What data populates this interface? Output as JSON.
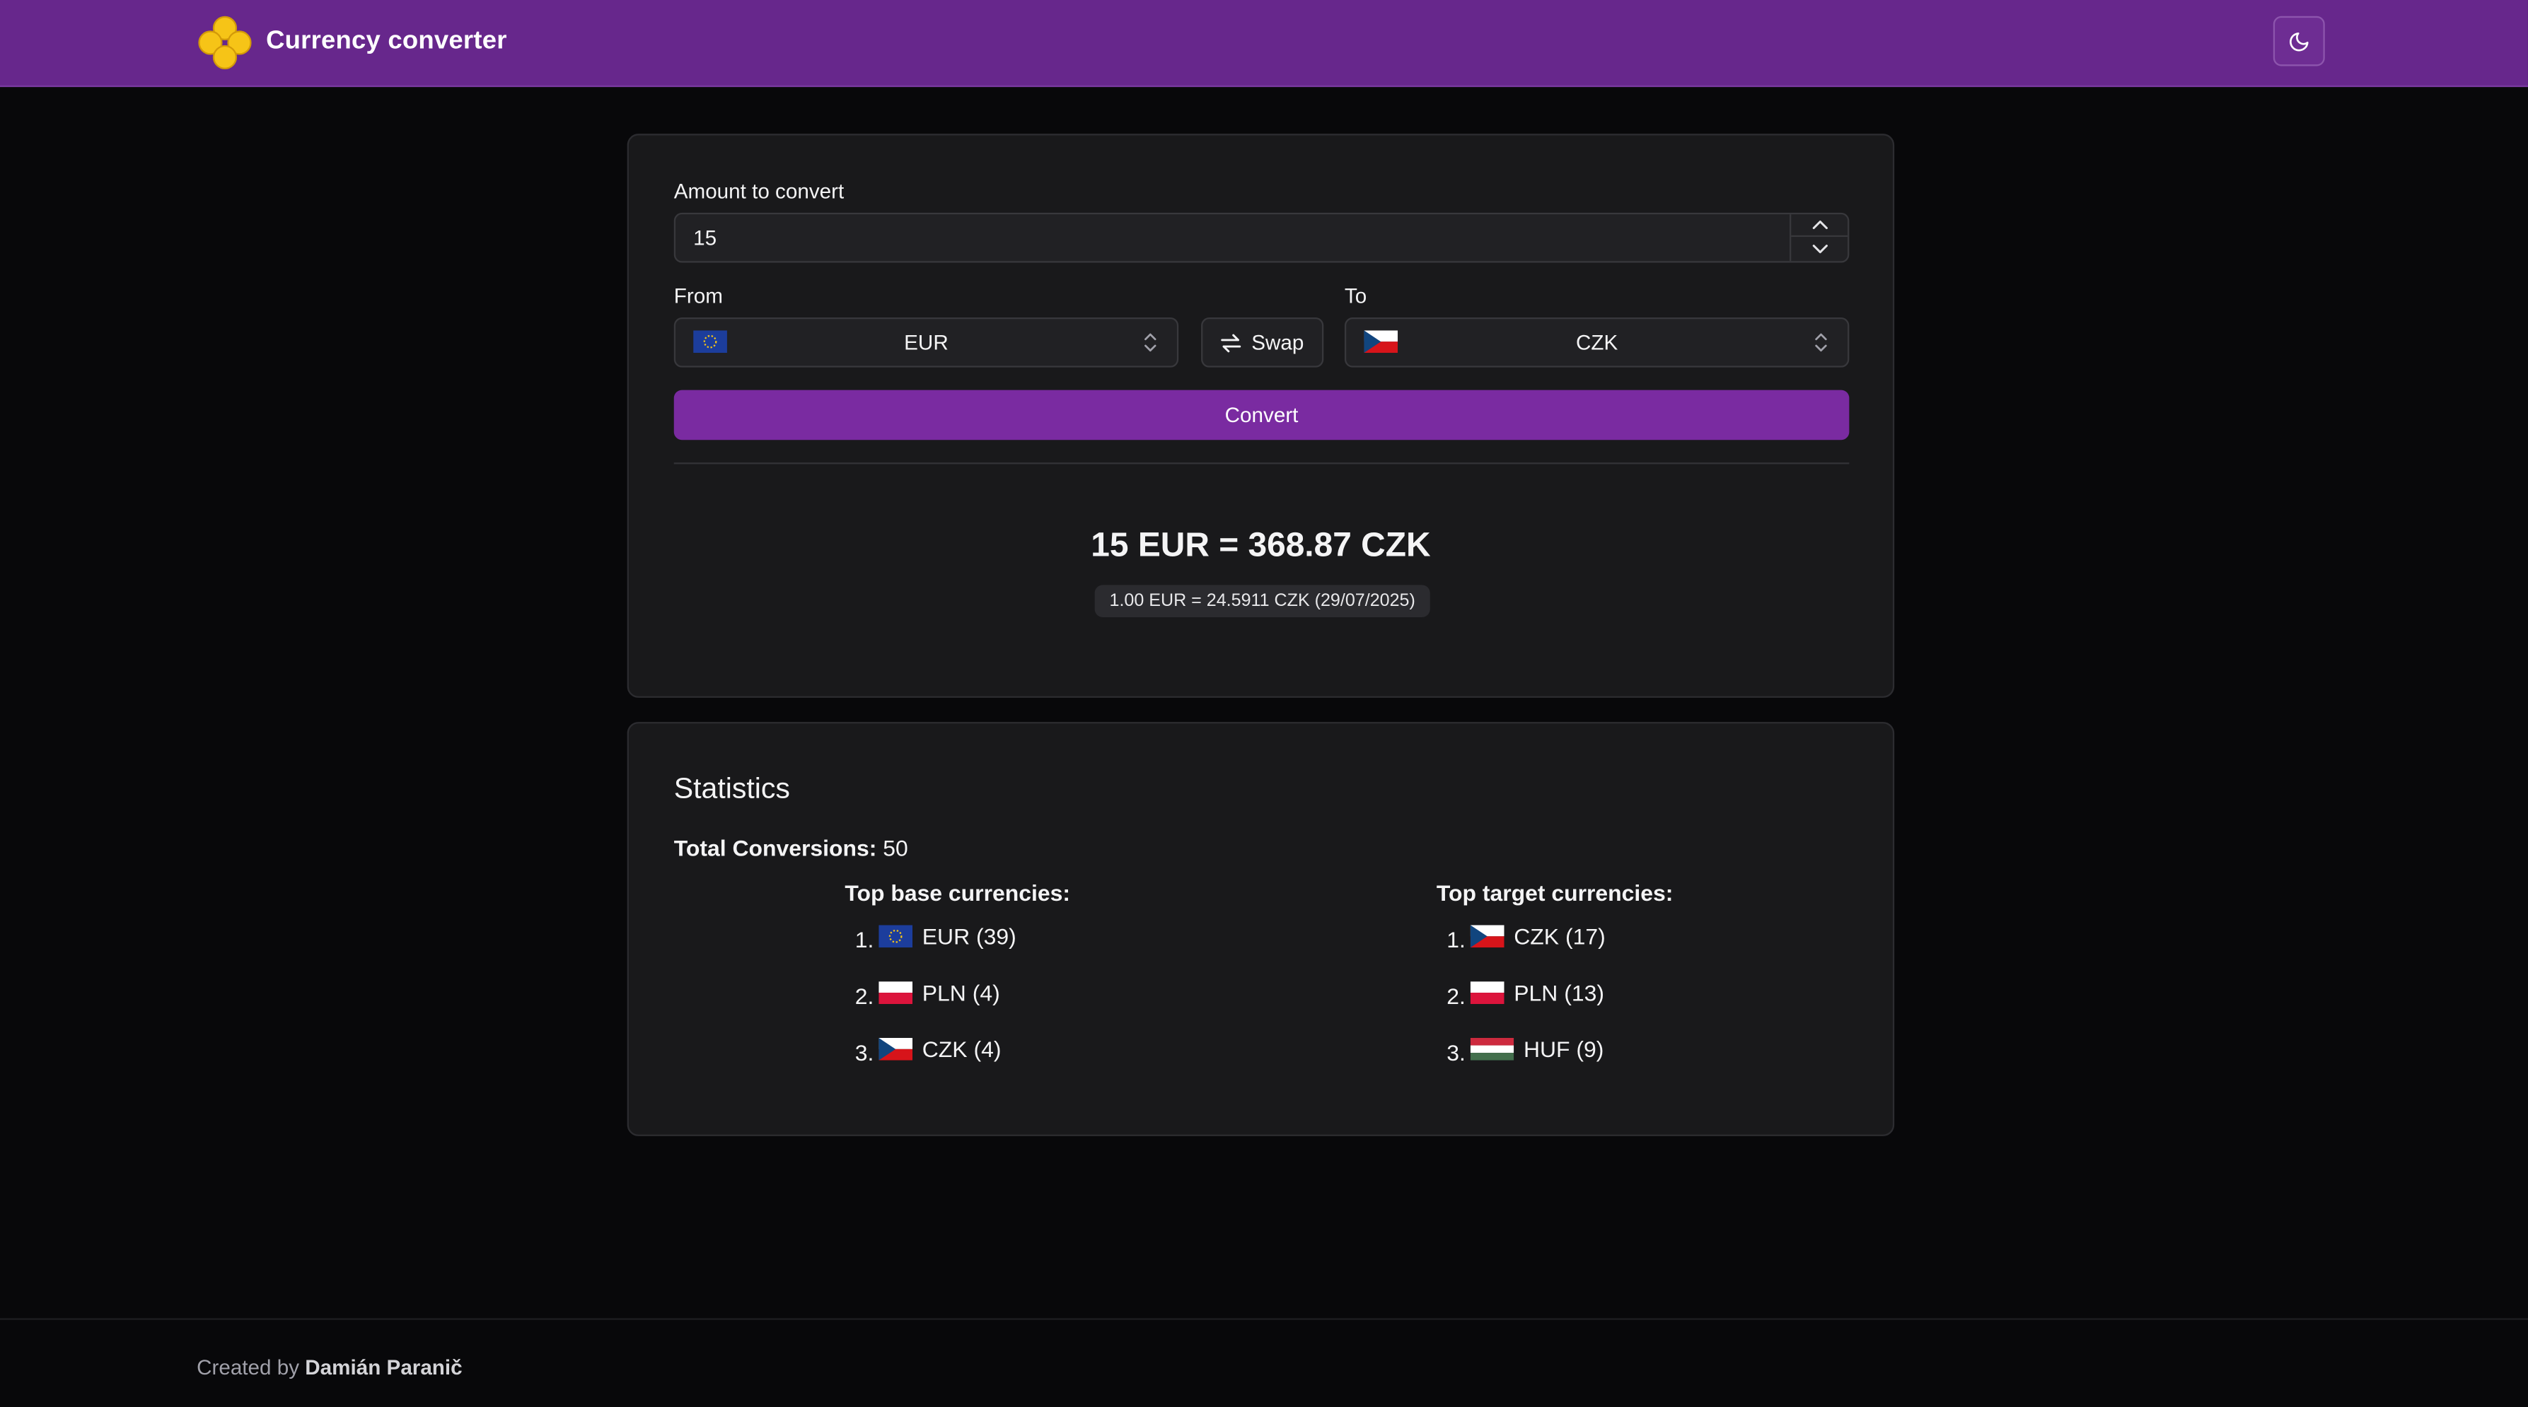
{
  "header": {
    "title": "Currency converter",
    "theme_icon": "moon-icon"
  },
  "converter": {
    "amount_label": "Amount to convert",
    "amount_value": "15",
    "from_label": "From",
    "from_currency": "EUR",
    "from_flag": "eu-flag",
    "swap_label": "Swap",
    "to_label": "To",
    "to_currency": "CZK",
    "to_flag": "cz-flag",
    "convert_label": "Convert",
    "result": "15 EUR = 368.87 CZK",
    "rate": "1.00 EUR = 24.5911 CZK (29/07/2025)"
  },
  "stats": {
    "title": "Statistics",
    "total_label": "Total Conversions:",
    "total_value": "50",
    "base_title": "Top base currencies:",
    "base": [
      {
        "rank": "1.",
        "label": "EUR (39)",
        "flag": "eu-flag"
      },
      {
        "rank": "2.",
        "label": "PLN (4)",
        "flag": "pl-flag"
      },
      {
        "rank": "3.",
        "label": "CZK (4)",
        "flag": "cz-flag"
      }
    ],
    "target_title": "Top target currencies:",
    "target": [
      {
        "rank": "1.",
        "label": "CZK (17)",
        "flag": "cz-flag"
      },
      {
        "rank": "2.",
        "label": "PLN (13)",
        "flag": "pl-flag"
      },
      {
        "rank": "3.",
        "label": "HUF (9)",
        "flag": "hu-flag"
      }
    ]
  },
  "footer": {
    "prefix": "Created by",
    "author": "Damián Paranič"
  },
  "colors": {
    "header": "#67278c",
    "accent": "#7a2ba1",
    "background": "#08080a",
    "card": "#19191b",
    "coin": "#f6c417"
  }
}
